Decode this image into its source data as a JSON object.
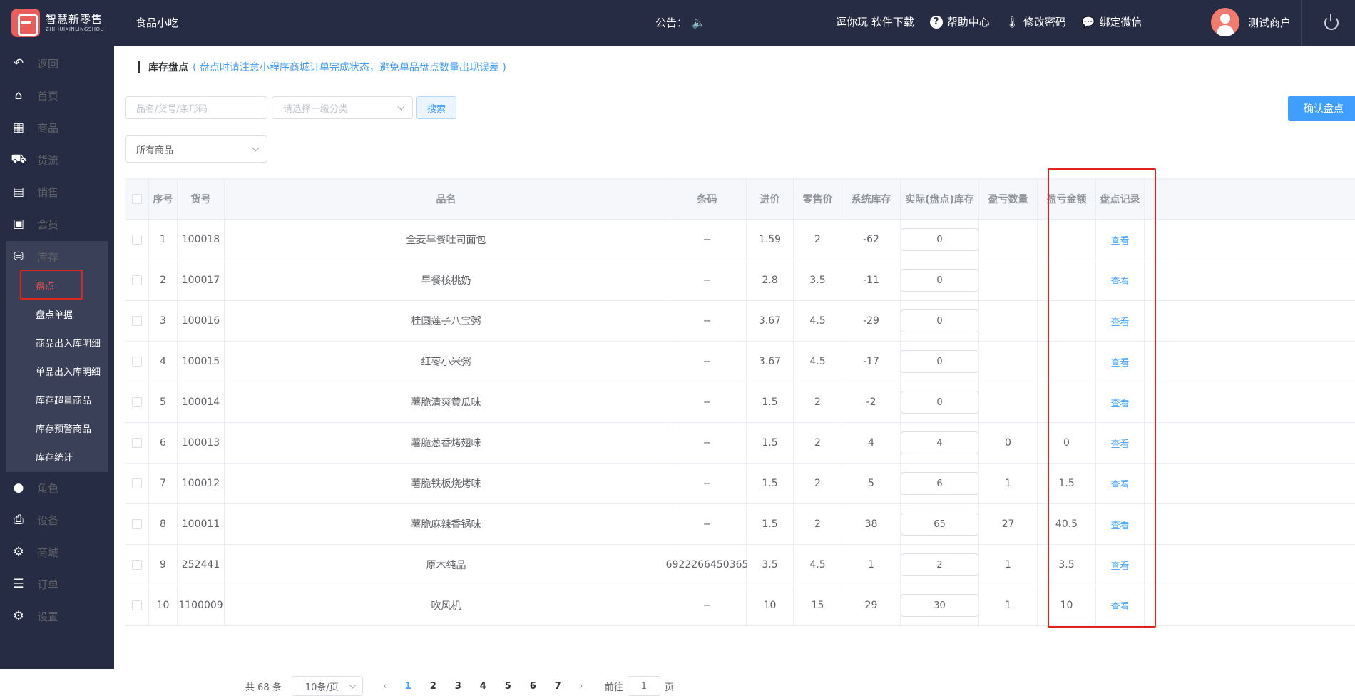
{
  "brand": {
    "name_cn": "智慧新零售",
    "name_en": "ZHIHUIXINLINGSHOU"
  },
  "header": {
    "store_name": "食品小吃",
    "notice_label": "公告：",
    "links": [
      "逗你玩 软件下载",
      "帮助中心",
      "修改密码",
      "绑定微信"
    ],
    "user_name": "测试商户"
  },
  "sidebar": {
    "items": [
      {
        "label": "返回",
        "icon": "back-icon"
      },
      {
        "label": "首页",
        "icon": "home-icon"
      },
      {
        "label": "商品",
        "icon": "grid-icon"
      },
      {
        "label": "货流",
        "icon": "truck-icon"
      },
      {
        "label": "销售",
        "icon": "bar-chart-icon"
      },
      {
        "label": "会员",
        "icon": "id-card-icon"
      },
      {
        "label": "库存",
        "icon": "database-icon"
      },
      {
        "label": "角色",
        "icon": "user-icon"
      },
      {
        "label": "设备",
        "icon": "printer-icon"
      },
      {
        "label": "商城",
        "icon": "gear-icon"
      },
      {
        "label": "订单",
        "icon": "list-icon"
      },
      {
        "label": "设置",
        "icon": "gear-icon"
      }
    ],
    "submenu": [
      "盘点",
      "盘点单据",
      "商品出入库明细",
      "单品出入库明细",
      "库存超量商品",
      "库存预警商品",
      "库存统计"
    ]
  },
  "page": {
    "title": "库存盘点",
    "hint": "( 盘点时请注意小程序商城订单完成状态，避免单品盘点数量出现误差 )",
    "search_placeholder": "品名/货号/条形码",
    "category_placeholder": "请选择一级分类",
    "search_button": "搜索",
    "confirm_button": "确认盘点",
    "filter_value": "所有商品"
  },
  "table": {
    "headers": [
      "序号",
      "货号",
      "品名",
      "条码",
      "进价",
      "零售价",
      "系统库存",
      "实际(盘点)库存",
      "盈亏数量",
      "盈亏金额",
      "盘点记录"
    ],
    "rows": [
      {
        "no": "1",
        "code": "100018",
        "name": "全麦早餐吐司面包",
        "barcode": "--",
        "cost": "1.59",
        "price": "2",
        "sys": "-62",
        "actual": "0",
        "diff_qty": "",
        "diff_amt": "",
        "record": "查看"
      },
      {
        "no": "2",
        "code": "100017",
        "name": "早餐核桃奶",
        "barcode": "--",
        "cost": "2.8",
        "price": "3.5",
        "sys": "-11",
        "actual": "0",
        "diff_qty": "",
        "diff_amt": "",
        "record": "查看"
      },
      {
        "no": "3",
        "code": "100016",
        "name": "桂圆莲子八宝粥",
        "barcode": "--",
        "cost": "3.67",
        "price": "4.5",
        "sys": "-29",
        "actual": "0",
        "diff_qty": "",
        "diff_amt": "",
        "record": "查看"
      },
      {
        "no": "4",
        "code": "100015",
        "name": "红枣小米粥",
        "barcode": "--",
        "cost": "3.67",
        "price": "4.5",
        "sys": "-17",
        "actual": "0",
        "diff_qty": "",
        "diff_amt": "",
        "record": "查看"
      },
      {
        "no": "5",
        "code": "100014",
        "name": "薯脆清爽黄瓜味",
        "barcode": "--",
        "cost": "1.5",
        "price": "2",
        "sys": "-2",
        "actual": "0",
        "diff_qty": "",
        "diff_amt": "",
        "record": "查看"
      },
      {
        "no": "6",
        "code": "100013",
        "name": "薯脆葱香烤翅味",
        "barcode": "--",
        "cost": "1.5",
        "price": "2",
        "sys": "4",
        "actual": "4",
        "diff_qty": "0",
        "diff_amt": "0",
        "record": "查看"
      },
      {
        "no": "7",
        "code": "100012",
        "name": "薯脆铁板烧烤味",
        "barcode": "--",
        "cost": "1.5",
        "price": "2",
        "sys": "5",
        "actual": "6",
        "diff_qty": "1",
        "diff_amt": "1.5",
        "record": "查看"
      },
      {
        "no": "8",
        "code": "100011",
        "name": "薯脆麻辣香锅味",
        "barcode": "--",
        "cost": "1.5",
        "price": "2",
        "sys": "38",
        "actual": "65",
        "diff_qty": "27",
        "diff_amt": "40.5",
        "record": "查看"
      },
      {
        "no": "9",
        "code": "252441",
        "name": "原木纯品",
        "barcode": "6922266450365",
        "cost": "3.5",
        "price": "4.5",
        "sys": "1",
        "actual": "2",
        "diff_qty": "1",
        "diff_amt": "3.5",
        "record": "查看"
      },
      {
        "no": "10",
        "code": "1100009",
        "name": "吹风机",
        "barcode": "--",
        "cost": "10",
        "price": "15",
        "sys": "29",
        "actual": "30",
        "diff_qty": "1",
        "diff_amt": "10",
        "record": "查看"
      }
    ]
  },
  "pagination": {
    "total": "共 68 条",
    "page_size": "10条/页",
    "pages": [
      "1",
      "2",
      "3",
      "4",
      "5",
      "6",
      "7"
    ],
    "current": "1",
    "goto_label": "前往",
    "goto_value": "1",
    "page_suffix": "页"
  }
}
